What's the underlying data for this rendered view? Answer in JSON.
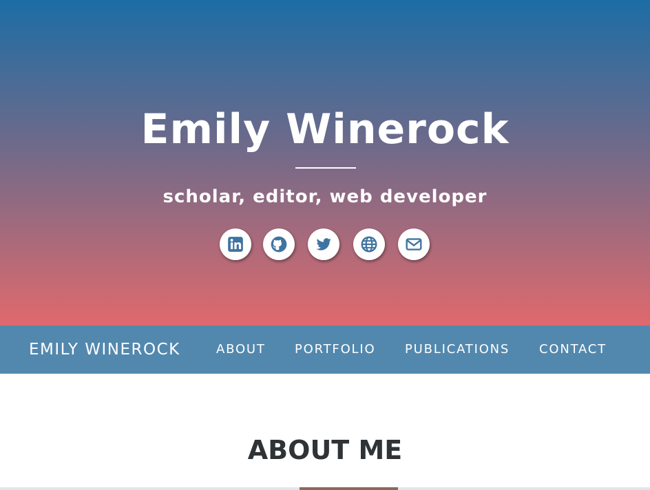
{
  "hero": {
    "title": "Emily Winerock",
    "tagline": "scholar, editor, web developer",
    "socials": [
      {
        "icon": "linkedin-icon"
      },
      {
        "icon": "github-icon"
      },
      {
        "icon": "twitter-icon"
      },
      {
        "icon": "globe-icon"
      },
      {
        "icon": "envelope-icon"
      }
    ],
    "icon_color": "#3f73a0"
  },
  "navbar": {
    "brand": "EMILY WINEROCK",
    "links": [
      "ABOUT",
      "PORTFOLIO",
      "PUBLICATIONS",
      "CONTACT"
    ],
    "background": "#5388ae"
  },
  "about": {
    "title": "ABOUT ME"
  }
}
